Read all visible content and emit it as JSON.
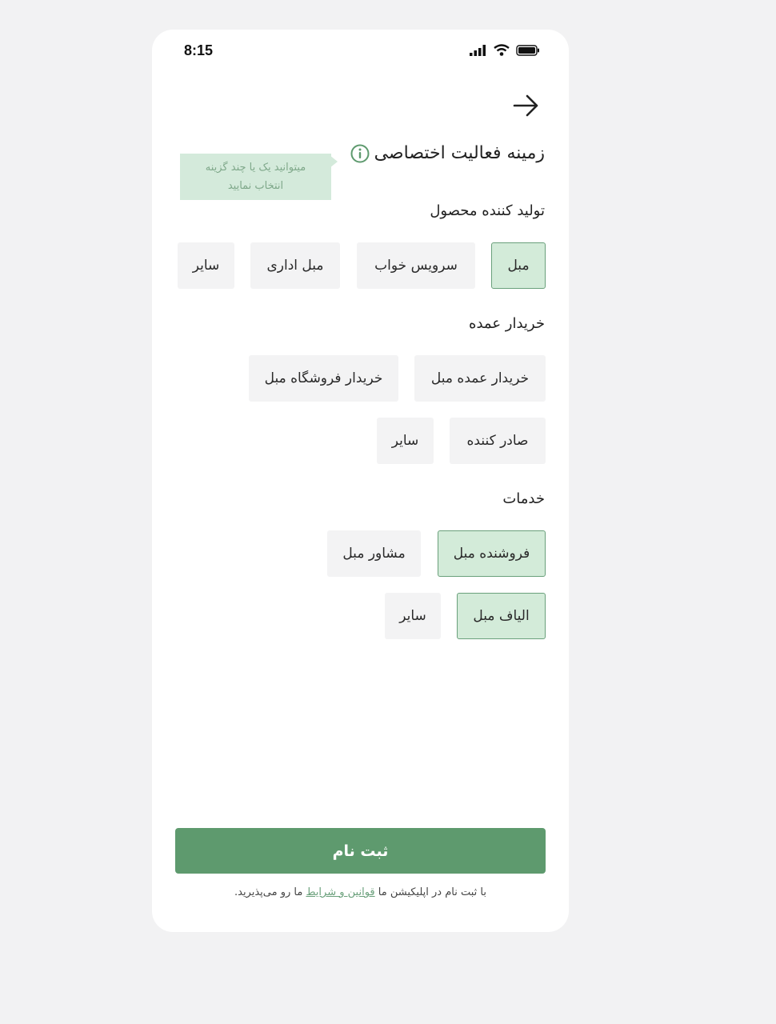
{
  "status_bar": {
    "time": "8:15"
  },
  "page": {
    "title": "زمینه فعالیت اختصاصی",
    "tooltip_line1": "میتوانید یک یا چند گزینه",
    "tooltip_line2": "انتخاب نمایید"
  },
  "sections": [
    {
      "title": "تولید کننده محصول",
      "chips": [
        {
          "label": "مبل",
          "selected": true
        },
        {
          "label": "سرویس خواب",
          "selected": false
        },
        {
          "label": "مبل اداری",
          "selected": false
        },
        {
          "label": "سایر",
          "selected": false
        }
      ]
    },
    {
      "title": "خریدار عمده",
      "chips": [
        {
          "label": "خریدار عمده مبل",
          "selected": false
        },
        {
          "label": "خریدار فروشگاه مبل",
          "selected": false
        },
        {
          "label": "صادر کننده",
          "selected": false
        },
        {
          "label": "سایر",
          "selected": false
        }
      ]
    },
    {
      "title": "خدمات",
      "chips": [
        {
          "label": "فروشنده مبل",
          "selected": true
        },
        {
          "label": "مشاور مبل",
          "selected": false
        },
        {
          "label": "الیاف مبل",
          "selected": true
        },
        {
          "label": "سایر",
          "selected": false
        }
      ]
    }
  ],
  "footer": {
    "submit_label": "ثبت نام",
    "terms_prefix": "با ثبت نام در اپلیکیشن ما ",
    "terms_link": "قوانین و شرایط",
    "terms_suffix": " ما رو می‌پذیرید."
  },
  "colors": {
    "accent": "#5e9a6e",
    "selected_bg": "#d3ebd9",
    "chip_bg": "#f3f3f4",
    "tooltip_bg": "#d4eadb"
  }
}
